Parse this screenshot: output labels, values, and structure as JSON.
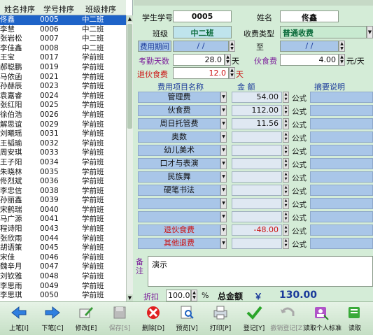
{
  "left_list": {
    "headers": [
      "姓名排序",
      "学号排序",
      "班级排序"
    ],
    "rows": [
      [
        "佟鑫",
        "0005",
        "中二班"
      ],
      [
        "李慧",
        "0006",
        "中二班"
      ],
      [
        "张岩松",
        "0007",
        "中二班"
      ],
      [
        "李佳鑫",
        "0008",
        "中二班"
      ],
      [
        "王宝",
        "0017",
        "学前班"
      ],
      [
        "郝聪鹏",
        "0019",
        "学前班"
      ],
      [
        "马依函",
        "0021",
        "学前班"
      ],
      [
        "孙赫辰",
        "0023",
        "学前班"
      ],
      [
        "袁嘉睿",
        "0024",
        "学前班"
      ],
      [
        "张红阳",
        "0025",
        "学前班"
      ],
      [
        "徐伯浩",
        "0026",
        "学前班"
      ],
      [
        "解思谊",
        "0029",
        "学前班"
      ],
      [
        "刘曦瑶",
        "0031",
        "学前班"
      ],
      [
        "王韬瑜",
        "0032",
        "学前班"
      ],
      [
        "周安琪",
        "0033",
        "学前班"
      ],
      [
        "王子阳",
        "0034",
        "学前班"
      ],
      [
        "朱晓林",
        "0035",
        "学前班"
      ],
      [
        "佟烈斌",
        "0036",
        "学前班"
      ],
      [
        "李忠信",
        "0038",
        "学前班"
      ],
      [
        "孙丽鑫",
        "0039",
        "学前班"
      ],
      [
        "宋鹤瑞",
        "0040",
        "学前班"
      ],
      [
        "马广源",
        "0041",
        "学前班"
      ],
      [
        "程诗阳",
        "0043",
        "学前班"
      ],
      [
        "张欣雨",
        "0044",
        "学前班"
      ],
      [
        "胡语策",
        "0045",
        "学前班"
      ],
      [
        "宋佳",
        "0046",
        "学前班"
      ],
      [
        "魏辛月",
        "0047",
        "学前班"
      ],
      [
        "刘钦雅",
        "0048",
        "学前班"
      ],
      [
        "李思雨",
        "0049",
        "学前班"
      ],
      [
        "李思琪",
        "0050",
        "学前班"
      ]
    ]
  },
  "form": {
    "student_no_label": "学生学号",
    "student_no": "0005",
    "name_label": "姓名",
    "name": "佟鑫",
    "class_label": "班级",
    "class_value": "中二班",
    "fee_type_label": "收费类型",
    "fee_type": "普通收费",
    "period_label": "费用期间",
    "period_from": "/   /",
    "period_to_label": "至",
    "period_to": "/   /",
    "attend_days_label": "考勤天数",
    "attend_days": "28.0",
    "days_unit": "天",
    "meal_fee_label": "伙食费",
    "meal_fee": "4.00",
    "meal_unit": "元/天",
    "refund_meal_label": "退伙食费",
    "refund_meal": "12.0",
    "refund_unit": "天"
  },
  "fee_table": {
    "col_name": "费用项目名称",
    "col_amount": "金    额",
    "col_desc": "摘要说明",
    "formula_label": "公式",
    "rows": [
      {
        "name": "管理费",
        "amount": "54.00",
        "red": false
      },
      {
        "name": "伙食费",
        "amount": "112.00",
        "red": false
      },
      {
        "name": "周日托管费",
        "amount": "11.56",
        "red": false
      },
      {
        "name": "奥数",
        "amount": "",
        "red": false
      },
      {
        "name": "幼儿美术",
        "amount": "",
        "red": false
      },
      {
        "name": "口才与表演",
        "amount": "",
        "red": false
      },
      {
        "name": "民族舞",
        "amount": "",
        "red": false
      },
      {
        "name": "硬笔书法",
        "amount": "",
        "red": false
      },
      {
        "name": "",
        "amount": "",
        "red": false
      },
      {
        "name": "",
        "amount": "",
        "red": false
      },
      {
        "name": "退伙食费",
        "amount": "-48.00",
        "red": true
      },
      {
        "name": "其他退费",
        "amount": "",
        "red": true
      }
    ]
  },
  "remark": {
    "label": "备注",
    "text": "演示"
  },
  "summary": {
    "discount_label": "折扣",
    "discount": "100.0",
    "percent": "%",
    "total_label": "总金额",
    "currency": "￥",
    "total": "130.00"
  },
  "toolbar": [
    {
      "label": "上笔[I]",
      "icon": "arrow-left-icon",
      "enabled": true
    },
    {
      "label": "下笔[C]",
      "icon": "arrow-right-icon",
      "enabled": true
    },
    {
      "label": "修改[E]",
      "icon": "edit-icon",
      "enabled": true
    },
    {
      "label": "保存[S]",
      "icon": "save-icon",
      "enabled": false
    },
    {
      "label": "删除[D]",
      "icon": "delete-icon",
      "enabled": true
    },
    {
      "label": "预览[V]",
      "icon": "preview-icon",
      "enabled": true
    },
    {
      "label": "打印[P]",
      "icon": "print-icon",
      "enabled": true
    },
    {
      "label": "登记[Y]",
      "icon": "check-icon",
      "enabled": true
    },
    {
      "label": "撤销登记[Z]",
      "icon": "undo-icon",
      "enabled": false
    },
    {
      "label": "读取个人标准",
      "icon": "personal-standard-icon",
      "enabled": true
    },
    {
      "label": "读取",
      "icon": "read-icon",
      "enabled": true
    }
  ]
}
